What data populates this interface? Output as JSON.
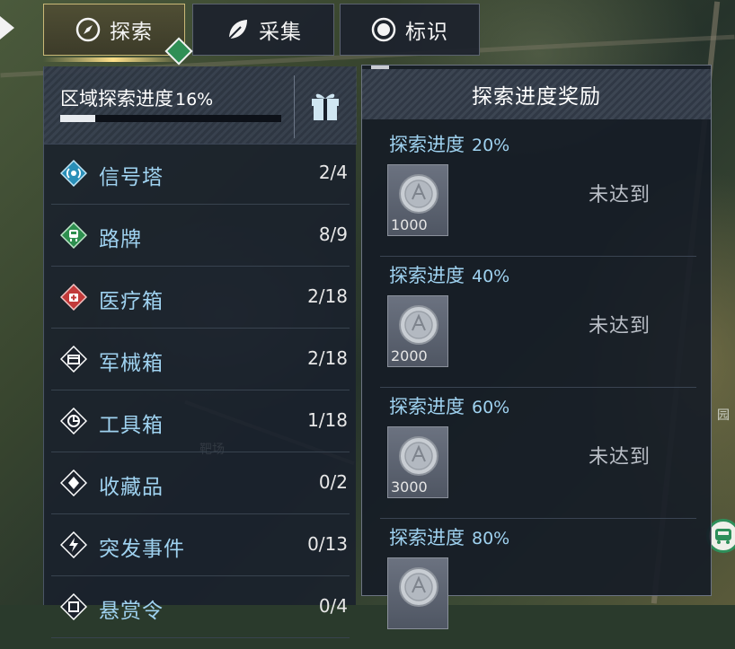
{
  "tabs": [
    {
      "label": "探索",
      "icon": "compass-icon",
      "active": true
    },
    {
      "label": "采集",
      "icon": "leaf-icon",
      "active": false
    },
    {
      "label": "标识",
      "icon": "target-icon",
      "active": false
    }
  ],
  "exploration": {
    "title": "区域探索进度",
    "percent_label": "16%",
    "progress": 0.16,
    "gift_icon": "gift-icon"
  },
  "categories": [
    {
      "label": "信号塔",
      "count": "2/4",
      "icon": "signal-tower-icon",
      "color": "#2a8fb8"
    },
    {
      "label": "路牌",
      "count": "8/9",
      "icon": "road-sign-icon",
      "color": "#2e8f4f"
    },
    {
      "label": "医疗箱",
      "count": "2/18",
      "icon": "medkit-icon",
      "color": "#c23a3a"
    },
    {
      "label": "军械箱",
      "count": "2/18",
      "icon": "ammo-box-icon",
      "color": "#ffffff"
    },
    {
      "label": "工具箱",
      "count": "1/18",
      "icon": "toolbox-icon",
      "color": "#ffffff"
    },
    {
      "label": "收藏品",
      "count": "0/2",
      "icon": "collectible-icon",
      "color": "#ffffff"
    },
    {
      "label": "突发事件",
      "count": "0/13",
      "icon": "lightning-icon",
      "color": "#ffffff"
    },
    {
      "label": "悬赏令",
      "count": "0/4",
      "icon": "bounty-icon",
      "color": "#ffffff"
    }
  ],
  "rewards_panel": {
    "title": "探索进度奖励",
    "items": [
      {
        "title": "探索进度",
        "percent": "20%",
        "amount": "1000",
        "status": "未达到"
      },
      {
        "title": "探索进度",
        "percent": "40%",
        "amount": "2000",
        "status": "未达到"
      },
      {
        "title": "探索进度",
        "percent": "60%",
        "amount": "3000",
        "status": "未达到"
      },
      {
        "title": "探索进度",
        "percent": "80%",
        "amount": "",
        "status": ""
      }
    ]
  },
  "map": {
    "labels": [
      "靶场",
      "园"
    ]
  },
  "colors": {
    "accent_blue": "#9fd2f0",
    "active_tab_border": "#c9b877",
    "panel_bg": "#18202c"
  }
}
